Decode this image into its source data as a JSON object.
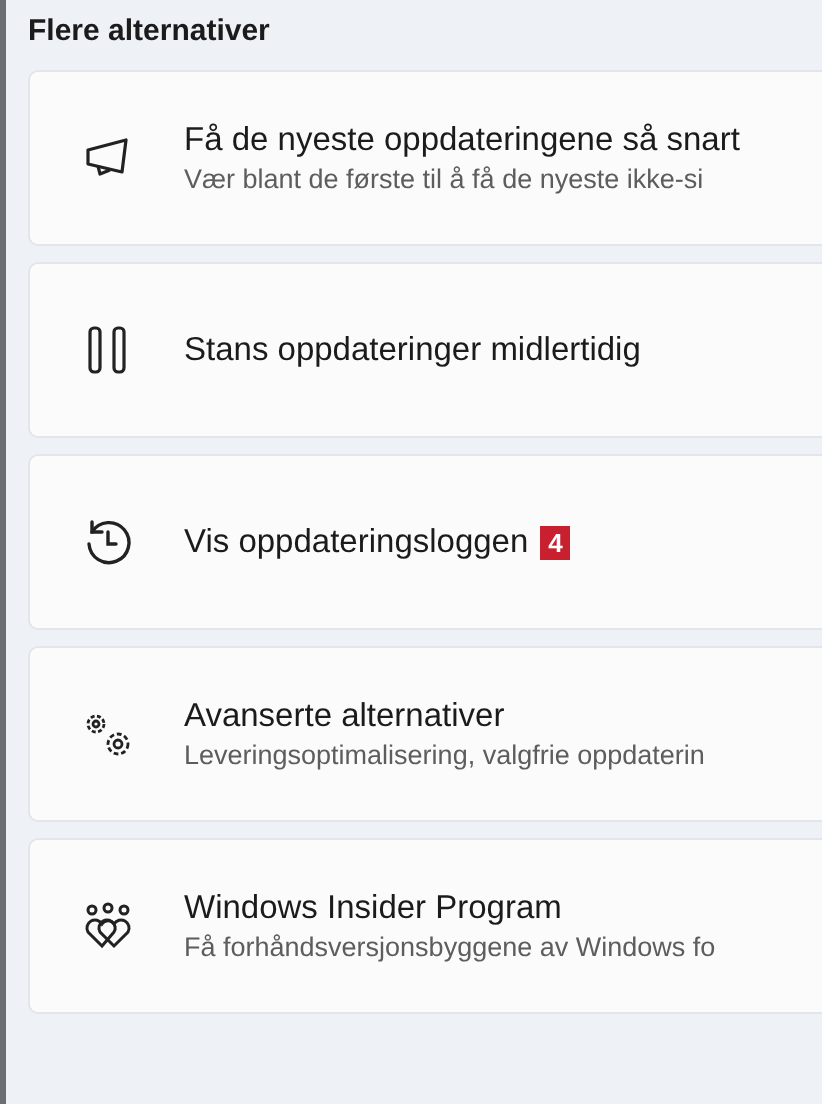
{
  "section_title": "Flere alternativer",
  "items": [
    {
      "kind": "megaphone",
      "title": "Få de nyeste oppdateringene så snart",
      "subtitle": "Vær blant de første til å få de nyeste ikke-si"
    },
    {
      "kind": "pause",
      "title": "Stans oppdateringer midlertidig"
    },
    {
      "kind": "history",
      "title": "Vis oppdateringsloggen",
      "badge": "4"
    },
    {
      "kind": "gears",
      "title": "Avanserte alternativer",
      "subtitle": "Leveringsoptimalisering, valgfrie oppdaterin"
    },
    {
      "kind": "insider",
      "title": "Windows Insider Program",
      "subtitle": "Få forhåndsversjonsbyggene av Windows fo"
    }
  ]
}
